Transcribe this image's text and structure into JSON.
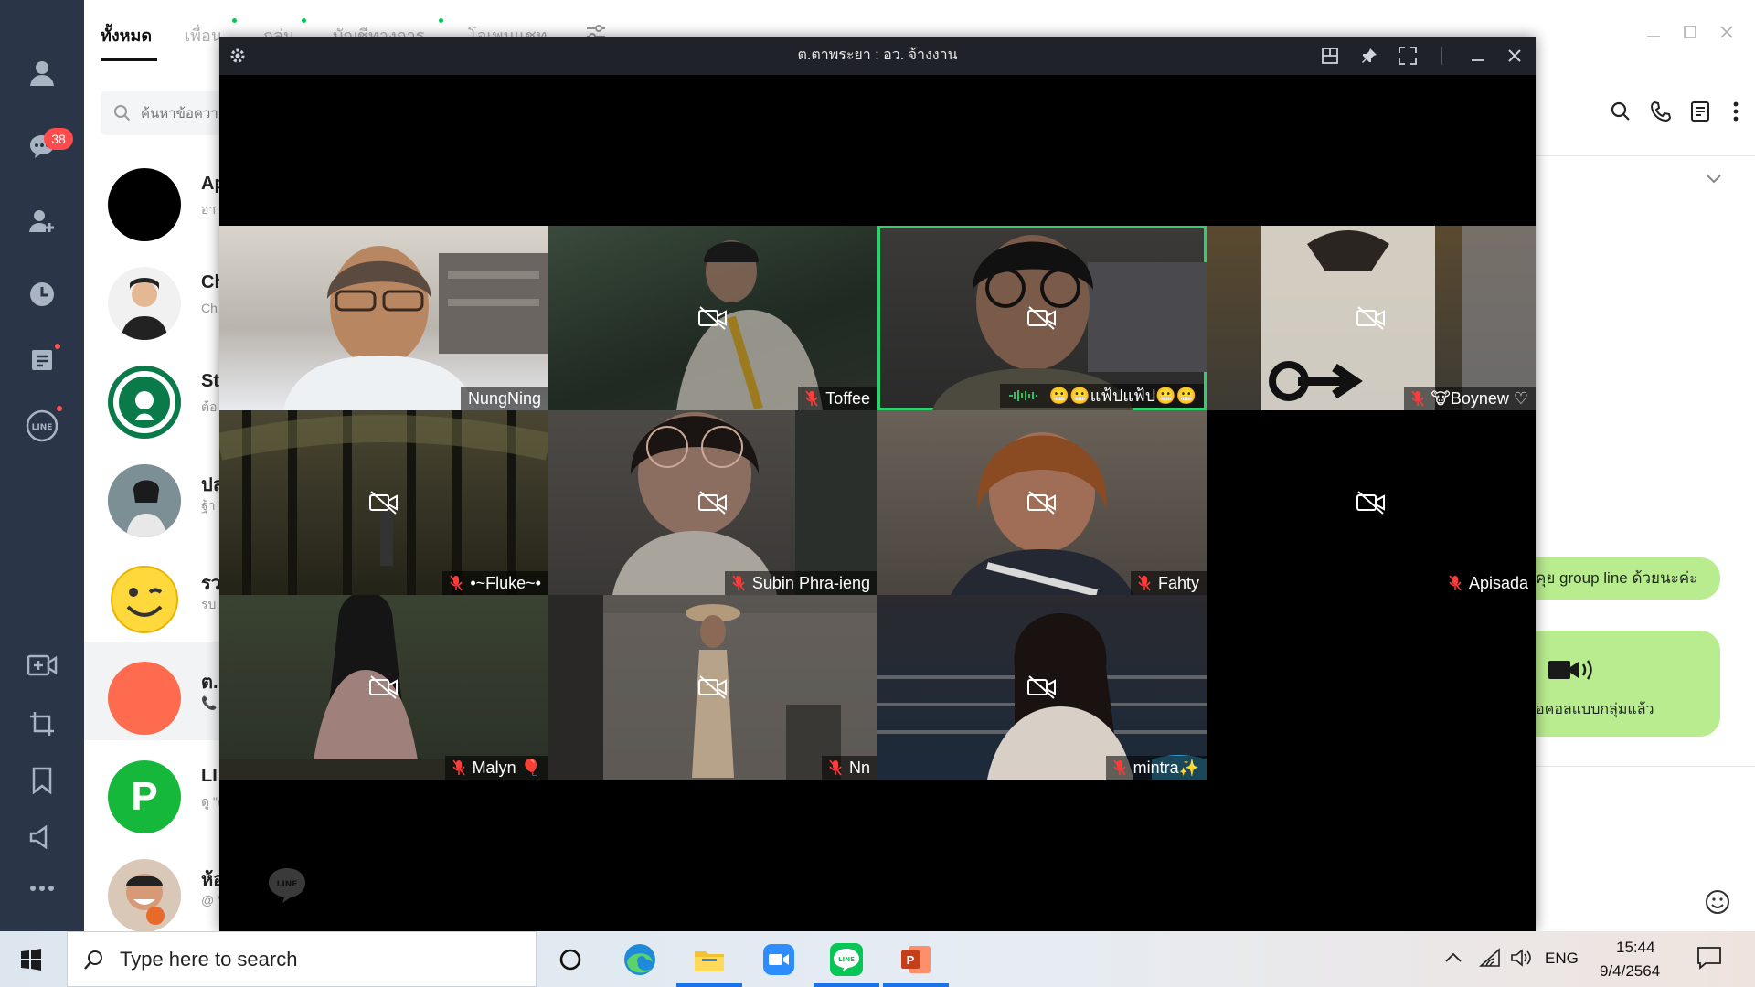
{
  "app": {
    "tabs": [
      {
        "label": "ทั้งหมด",
        "active": true
      },
      {
        "label": "เพื่อน"
      },
      {
        "label": "กลุ่ม"
      },
      {
        "label": "บัญชีทางการ"
      },
      {
        "label": "โอเพนแชท"
      }
    ],
    "search_placeholder": "ค้นหาข้อความ",
    "unread_badge": "38",
    "chats": [
      {
        "name": "Ap",
        "preview": "อา"
      },
      {
        "name": "Ch",
        "preview": "Ch"
      },
      {
        "name": "St",
        "preview": "ต้อ กับ"
      },
      {
        "name": "ปล",
        "preview": "ฐ้า"
      },
      {
        "name": "รว",
        "preview": "รบ ห้อ"
      },
      {
        "name": "ต.",
        "preview": "📞"
      },
      {
        "name": "LI",
        "preview": "ดู \"ดู"
      },
      {
        "name": "ห้อ",
        "preview": "@ \"ไล"
      }
    ],
    "messages": [
      {
        "text": "คุย group line ด้วยนะค่ะ"
      },
      {
        "text": "อคอลแบบกลุ่มแล้ว"
      }
    ]
  },
  "call": {
    "title": "ต.ตาพระยา : อว. จ้างงาน",
    "participants": [
      {
        "name": "NungNing",
        "camera": true,
        "muted": false
      },
      {
        "name": "Toffee",
        "camera": false,
        "muted": true
      },
      {
        "name": "😬😬แฟ้ปแฟ้ป😬😬",
        "camera": false,
        "muted": false,
        "speaking": true
      },
      {
        "name": "🐮Boynew ♡",
        "camera": false,
        "muted": true
      },
      {
        "name": "•~Fluke~•",
        "camera": false,
        "muted": true
      },
      {
        "name": "Subin Phra-ieng",
        "camera": false,
        "muted": true
      },
      {
        "name": "Fahty",
        "camera": false,
        "muted": true
      },
      {
        "name": "Apisada",
        "camera": false,
        "muted": true
      },
      {
        "name": "Malyn 🎈",
        "camera": false,
        "muted": true
      },
      {
        "name": "Nn",
        "camera": false,
        "muted": true
      },
      {
        "name": "mintra✨",
        "camera": false,
        "muted": true
      }
    ],
    "watermark": "LINE"
  },
  "taskbar": {
    "search_placeholder": "Type here to search",
    "language": "ENG",
    "time": "15:44",
    "date": "9/4/2564"
  },
  "colors": {
    "sidebar": "#2b3548",
    "line_green": "#06c755",
    "speaking_border": "#2ad46b",
    "bubble": "#b9ec8f"
  }
}
